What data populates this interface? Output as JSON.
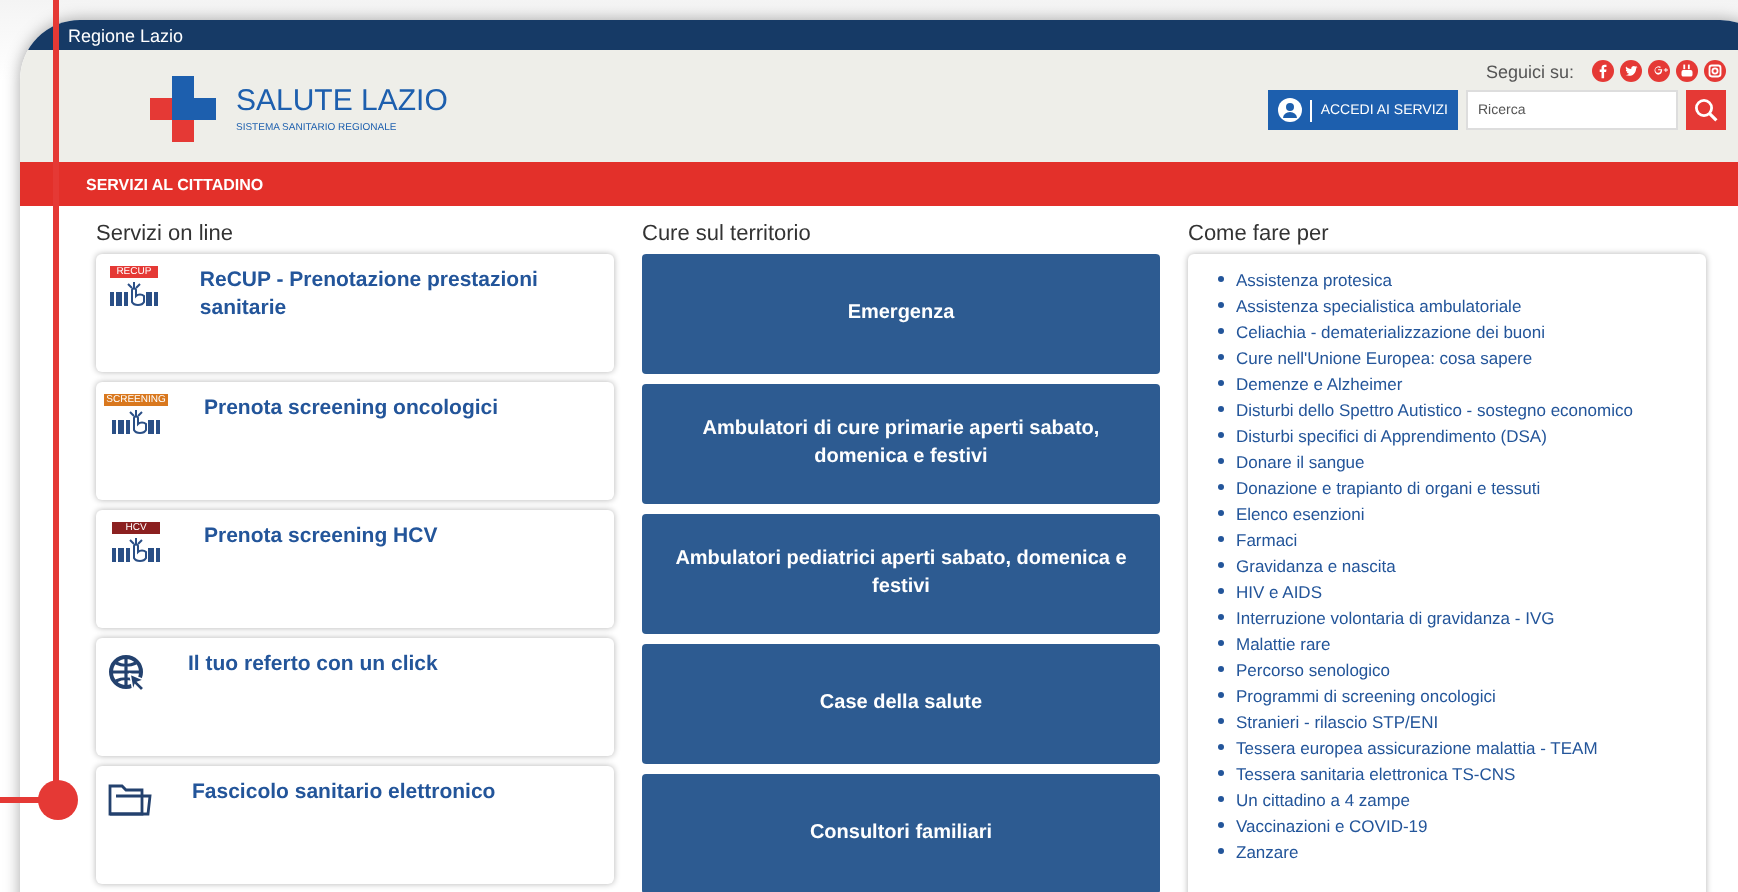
{
  "top_bar": {
    "title": "Regione Lazio"
  },
  "header": {
    "logo_title": "SALUTE LAZIO",
    "logo_subtitle": "SISTEMA SANITARIO REGIONALE",
    "follow_label": "Seguici su:",
    "login_button": "ACCEDI AI SERVIZI",
    "search": {
      "placeholder": "Ricerca"
    }
  },
  "nav": {
    "label": "SERVIZI AL CITTADINO"
  },
  "online_services": {
    "heading": "Servizi on line",
    "cards": [
      {
        "kind": "badge",
        "badge": "RECUP",
        "color": "#e53935",
        "label": "ReCUP - Prenotazione prestazioni sanitarie"
      },
      {
        "kind": "badge",
        "badge": "SCREENING",
        "color": "#d9781e",
        "label": "Prenota screening oncologici"
      },
      {
        "kind": "badge",
        "badge": "HCV",
        "color": "#8b2020",
        "label": "Prenota screening HCV"
      },
      {
        "kind": "globe",
        "label": "Il tuo referto con un click"
      },
      {
        "kind": "folder",
        "label": "Fascicolo sanitario elettronico"
      }
    ]
  },
  "territory_care": {
    "heading": "Cure sul territorio",
    "buttons": [
      "Emergenza",
      "Ambulatori di cure primarie aperti sabato, domenica e festivi",
      "Ambulatori pediatrici aperti sabato, domenica e festivi",
      "Case della salute",
      "Consultori familiari"
    ]
  },
  "how_to": {
    "heading": "Come fare per",
    "links": [
      "Assistenza protesica",
      "Assistenza specialistica ambulatoriale",
      "Celiachia - dematerializzazione dei buoni",
      "Cure nell'Unione Europea: cosa sapere",
      "Demenze e Alzheimer",
      "Disturbi dello Spettro Autistico - sostegno economico",
      "Disturbi specifici di Apprendimento (DSA)",
      "Donare il sangue",
      "Donazione e trapianto di organi e tessuti",
      "Elenco esenzioni",
      "Farmaci",
      "Gravidanza e nascita",
      "HIV e AIDS",
      "Interruzione volontaria di gravidanza - IVG",
      "Malattie rare",
      "Percorso senologico",
      "Programmi di screening oncologici",
      "Stranieri - rilascio STP/ENI",
      "Tessera europea assicurazione malattia - TEAM",
      "Tessera sanitaria elettronica TS-CNS",
      "Un cittadino a 4 zampe",
      "Vaccinazioni e COVID-19",
      "Zanzare"
    ]
  }
}
